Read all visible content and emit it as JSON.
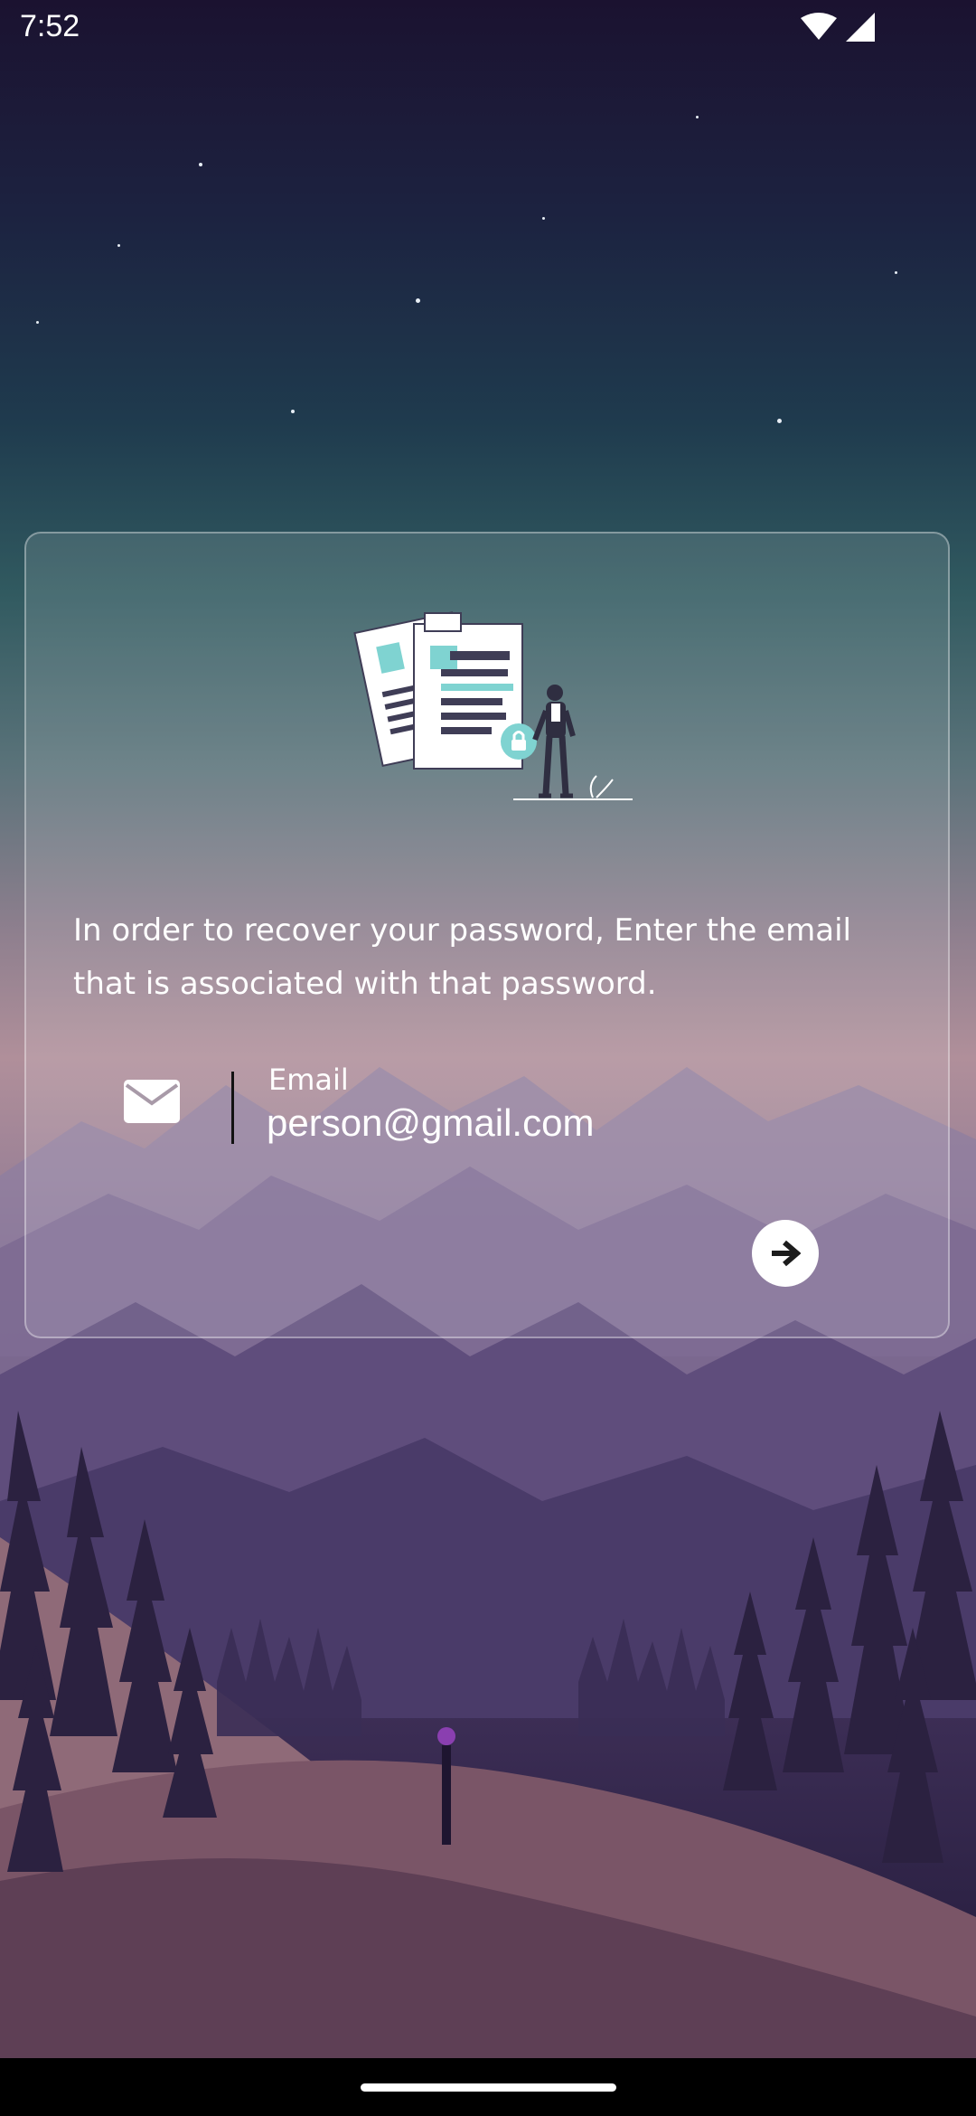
{
  "status_bar": {
    "time": "7:52",
    "icons": [
      "wifi-icon",
      "signal-icon"
    ]
  },
  "card": {
    "illustration": "forgot-password-illustration",
    "instructions": "In order to recover your password, Enter the email that is associated with that password.",
    "email": {
      "icon": "mail-icon",
      "label": "Email",
      "value": "person@gmail.com"
    },
    "next_button_icon": "arrow-right-icon"
  },
  "colors": {
    "accent": "#7fd3d1",
    "text": "#ffffff"
  }
}
